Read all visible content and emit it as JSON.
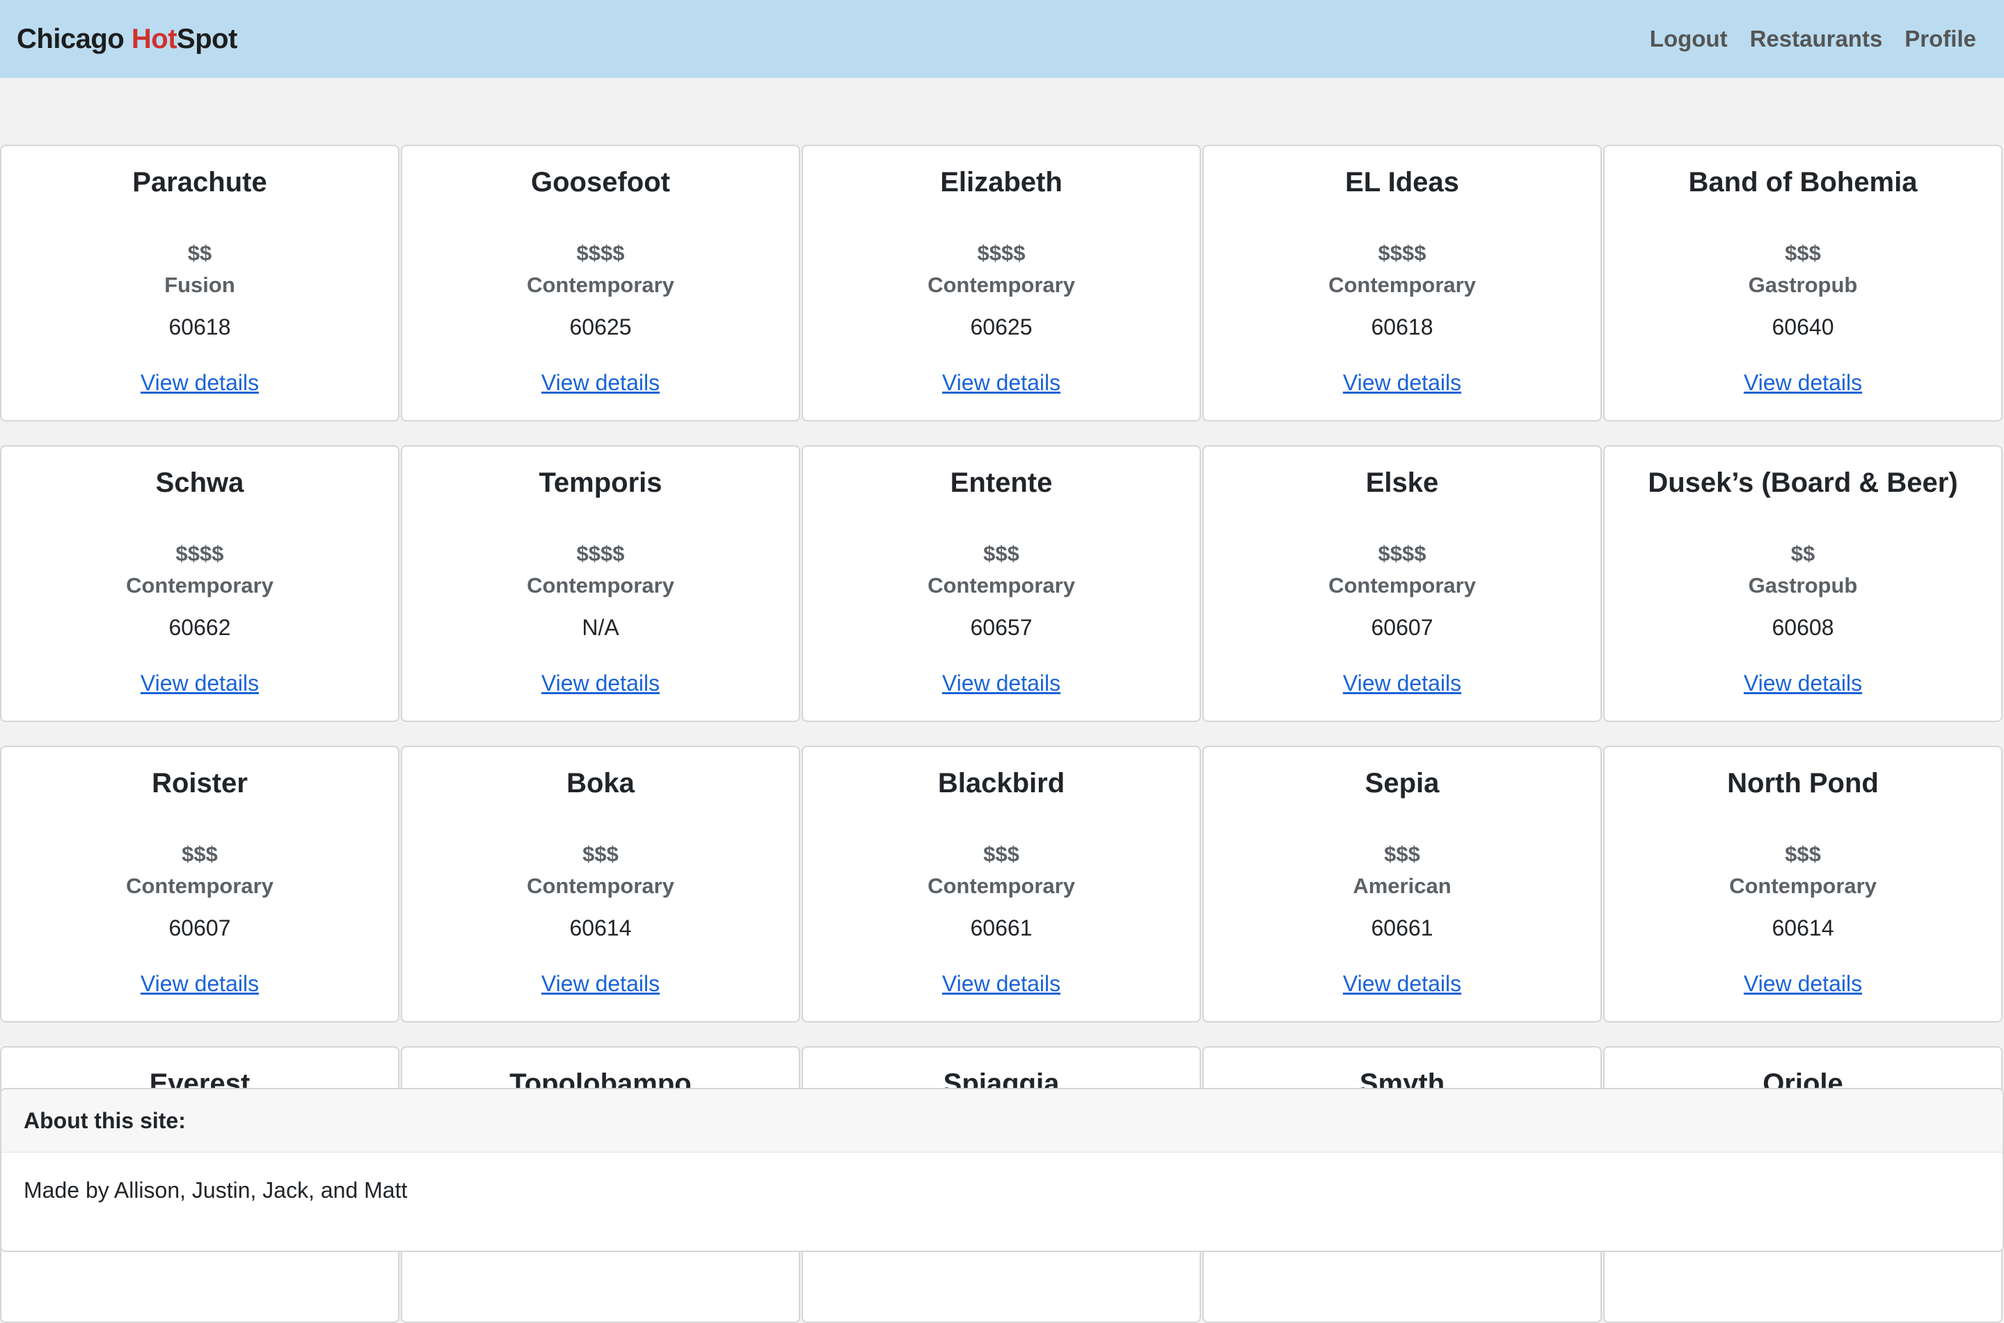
{
  "navbar": {
    "brand_prefix": "Chicago ",
    "brand_hot": "Hot",
    "brand_suffix": "Spot",
    "links": [
      "Logout",
      "Restaurants",
      "Profile"
    ]
  },
  "restaurants": [
    {
      "name": "Parachute",
      "price": "$$",
      "cuisine": "Fusion",
      "zip": "60618",
      "link": "View details"
    },
    {
      "name": "Goosefoot",
      "price": "$$$$",
      "cuisine": "Contemporary",
      "zip": "60625",
      "link": "View details"
    },
    {
      "name": "Elizabeth",
      "price": "$$$$",
      "cuisine": "Contemporary",
      "zip": "60625",
      "link": "View details"
    },
    {
      "name": "EL Ideas",
      "price": "$$$$",
      "cuisine": "Contemporary",
      "zip": "60618",
      "link": "View details"
    },
    {
      "name": "Band of Bohemia",
      "price": "$$$",
      "cuisine": "Gastropub",
      "zip": "60640",
      "link": "View details"
    },
    {
      "name": "Schwa",
      "price": "$$$$",
      "cuisine": "Contemporary",
      "zip": "60662",
      "link": "View details"
    },
    {
      "name": "Temporis",
      "price": "$$$$",
      "cuisine": "Contemporary",
      "zip": "N/A",
      "link": "View details"
    },
    {
      "name": "Entente",
      "price": "$$$",
      "cuisine": "Contemporary",
      "zip": "60657",
      "link": "View details"
    },
    {
      "name": "Elske",
      "price": "$$$$",
      "cuisine": "Contemporary",
      "zip": "60607",
      "link": "View details"
    },
    {
      "name": "Dusek’s (Board & Beer)",
      "price": "$$",
      "cuisine": "Gastropub",
      "zip": "60608",
      "link": "View details"
    },
    {
      "name": "Roister",
      "price": "$$$",
      "cuisine": "Contemporary",
      "zip": "60607",
      "link": "View details"
    },
    {
      "name": "Boka",
      "price": "$$$",
      "cuisine": "Contemporary",
      "zip": "60614",
      "link": "View details"
    },
    {
      "name": "Blackbird",
      "price": "$$$",
      "cuisine": "Contemporary",
      "zip": "60661",
      "link": "View details"
    },
    {
      "name": "Sepia",
      "price": "$$$",
      "cuisine": "American",
      "zip": "60661",
      "link": "View details"
    },
    {
      "name": "North Pond",
      "price": "$$$",
      "cuisine": "Contemporary",
      "zip": "60614",
      "link": "View details"
    },
    {
      "name": "Everest",
      "price": "",
      "cuisine": "",
      "zip": "",
      "link": ""
    },
    {
      "name": "Topolobampo",
      "price": "",
      "cuisine": "",
      "zip": "",
      "link": ""
    },
    {
      "name": "Spiaggia",
      "price": "",
      "cuisine": "",
      "zip": "",
      "link": ""
    },
    {
      "name": "Smyth",
      "price": "",
      "cuisine": "",
      "zip": "",
      "link": ""
    },
    {
      "name": "Oriole",
      "price": "",
      "cuisine": "",
      "zip": "",
      "link": ""
    }
  ],
  "footer": {
    "header": "About this site:",
    "body": "Made by Allison, Justin, Jack, and Matt"
  },
  "colors": {
    "navbar_bg": "#bbdcf0",
    "brand_hot": "#d0312d",
    "link": "#1a63d8",
    "page_bg": "#f2f2f2"
  }
}
